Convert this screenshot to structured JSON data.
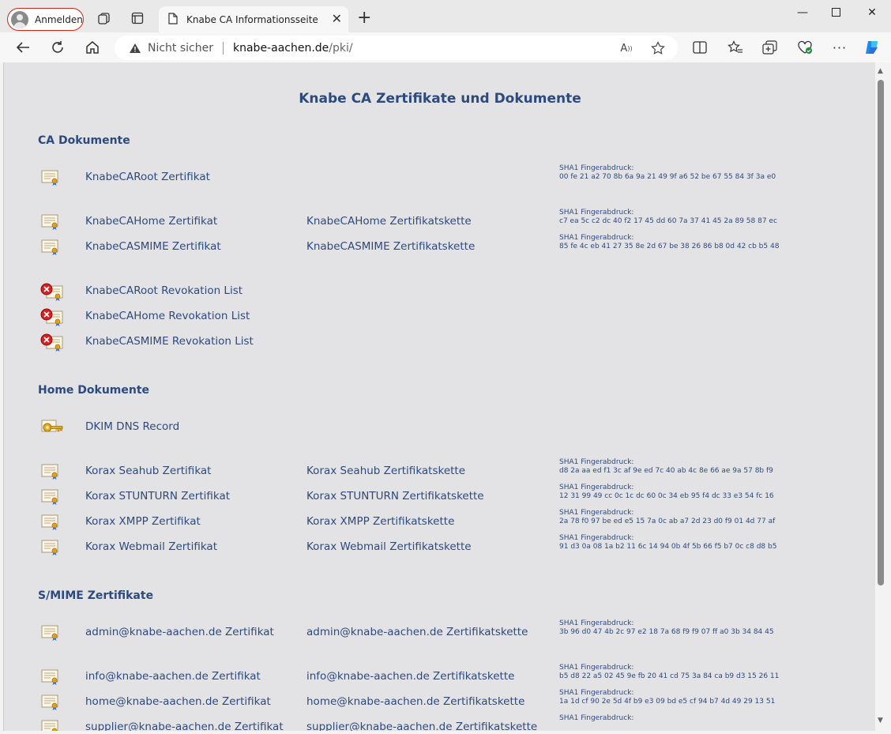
{
  "browser": {
    "profile_label": "Anmelden",
    "tab_title": "Knabe CA Informationsseite",
    "security_label": "Nicht sicher",
    "url_host": "knabe-aachen.de",
    "url_path": "/pki/"
  },
  "page": {
    "title": "Knabe CA Zertifikate und Dokumente",
    "fp_label": "SHA1 Fingerabdruck:",
    "sections": [
      {
        "title": "CA Dokumente"
      },
      {
        "title": "Home Dokumente"
      },
      {
        "title": "S/MIME Zertifikate"
      }
    ],
    "rows": [
      {
        "icon": "certificate-icon",
        "cert": "KnabeCARoot Zertifikat",
        "chain": "",
        "fp": "00 fe 21 a2 70 8b 6a 9a 21 49 9f a6 52 be 67 55 84 3f 3a e0"
      },
      {
        "icon": "certificate-icon",
        "cert": "KnabeCAHome Zertifikat",
        "chain": "KnabeCAHome Zertifikatskette",
        "fp": "c7 ea 5c c2 dc 40 f2 17 45 dd 60 7a 37 41 45 2a 89 58 87 ec"
      },
      {
        "icon": "certificate-icon",
        "cert": "KnabeCASMIME Zertifikat",
        "chain": "KnabeCASMIME Zertifikatskette",
        "fp": "85 fe 4c eb 41 27 35 8e 2d 67 be 38 26 86 b8 0d 42 cb b5 48"
      },
      {
        "icon": "revocation-icon",
        "cert": "KnabeCARoot Revokation List",
        "chain": "",
        "fp": ""
      },
      {
        "icon": "revocation-icon",
        "cert": "KnabeCAHome Revokation List",
        "chain": "",
        "fp": ""
      },
      {
        "icon": "revocation-icon",
        "cert": "KnabeCASMIME Revokation List",
        "chain": "",
        "fp": ""
      },
      {
        "icon": "key-icon",
        "cert": "DKIM DNS Record",
        "chain": "",
        "fp": ""
      },
      {
        "icon": "certificate-icon",
        "cert": "Korax Seahub Zertifikat",
        "chain": "Korax Seahub Zertifikatskette",
        "fp": "d8 2a aa ed f1 3c af 9e ed 7c 40 ab 4c 8e 66 ae 9a 57 8b f9"
      },
      {
        "icon": "certificate-icon",
        "cert": "Korax STUNTURN Zertifikat",
        "chain": "Korax STUNTURN Zertifikatskette",
        "fp": "12 31 99 49 cc 0c 1c dc 60 0c 34 eb 95 f4 dc 33 e3 54 fc 16"
      },
      {
        "icon": "certificate-icon",
        "cert": "Korax XMPP Zertifikat",
        "chain": "Korax XMPP Zertifikatskette",
        "fp": "2a 78 f0 97 be ed e5 15 7a 0c ab a7 2d 23 d0 f9 01 4d 77 af"
      },
      {
        "icon": "certificate-icon",
        "cert": "Korax Webmail Zertifikat",
        "chain": "Korax Webmail Zertifikatskette",
        "fp": "91 d3 0a 08 1a b2 11 6c 14 94 0b 4f 5b 66 f5 b7 0c c8 d8 b5"
      },
      {
        "icon": "certificate-icon",
        "cert": "admin@knabe-aachen.de Zertifikat",
        "chain": "admin@knabe-aachen.de Zertifikatskette",
        "fp": "3b 96 d0 47 4b 2c 97 e2 18 7a 68 f9 f9 07 ff a0 3b 34 84 45"
      },
      {
        "icon": "certificate-icon",
        "cert": "info@knabe-aachen.de Zertifikat",
        "chain": "info@knabe-aachen.de Zertifikatskette",
        "fp": "b5 d8 22 a5 02 45 9e fb 20 41 cd 75 3a 84 ca b9 d3 15 26 11"
      },
      {
        "icon": "certificate-icon",
        "cert": "home@knabe-aachen.de Zertifikat",
        "chain": "home@knabe-aachen.de Zertifikatskette",
        "fp": "1a 1d cf 90 2e 5d 4f b9 e3 09 bd e5 cf 94 b7 4d 49 29 13 51"
      },
      {
        "icon": "certificate-icon",
        "cert": "supplier@knabe-aachen.de Zertifikat",
        "chain": "supplier@knabe-aachen.de Zertifikatskette",
        "fp": ""
      }
    ]
  }
}
